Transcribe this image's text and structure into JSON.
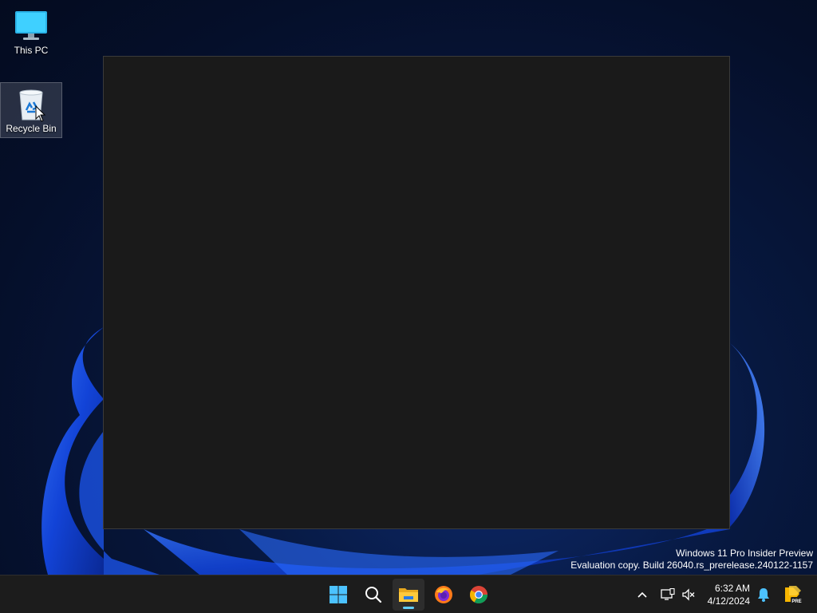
{
  "desktop": {
    "icons": [
      {
        "label": "This PC",
        "icon": "monitor-icon"
      },
      {
        "label": "Recycle Bin",
        "icon": "recycle-bin-icon"
      }
    ]
  },
  "watermark": {
    "line1": "Windows 11 Pro Insider Preview",
    "line2": "Evaluation copy. Build 26040.rs_prerelease.240122-1157"
  },
  "taskbar": {
    "apps": [
      {
        "name": "Start",
        "icon": "windows-start-icon"
      },
      {
        "name": "Search",
        "icon": "search-icon"
      },
      {
        "name": "File Explorer",
        "icon": "folder-icon",
        "active": true
      },
      {
        "name": "Firefox",
        "icon": "firefox-icon"
      },
      {
        "name": "Chrome",
        "icon": "chrome-icon"
      }
    ],
    "tray": {
      "time": "6:32 AM",
      "date": "4/12/2024",
      "badge": "PRE"
    }
  },
  "colors": {
    "accent": "#60cdff",
    "taskbar": "#1c1c1c",
    "window": "#1a1a1a"
  }
}
